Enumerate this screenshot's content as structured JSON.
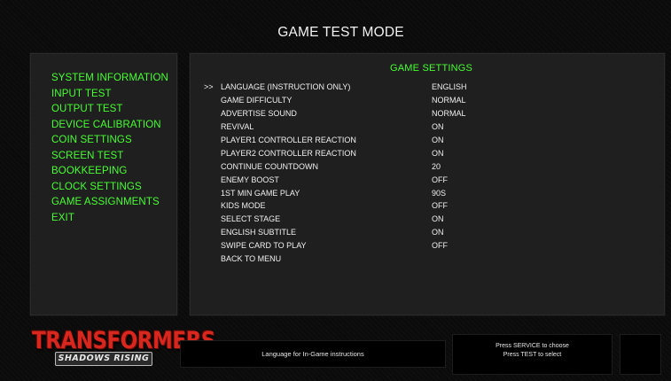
{
  "header": {
    "title": "GAME TEST MODE"
  },
  "menu": {
    "items": [
      "SYSTEM INFORMATION",
      "INPUT TEST",
      "OUTPUT TEST",
      "DEVICE CALIBRATION",
      "COIN SETTINGS",
      "SCREEN TEST",
      "BOOKKEEPING",
      "CLOCK SETTINGS",
      "GAME ASSIGNMENTS",
      "EXIT"
    ]
  },
  "settings": {
    "title": "GAME SETTINGS",
    "cursor": ">>",
    "rows": [
      {
        "label": "LANGUAGE (INSTRUCTION ONLY)",
        "value": "ENGLISH"
      },
      {
        "label": "GAME DIFFICULTY",
        "value": "NORMAL"
      },
      {
        "label": "ADVERTISE SOUND",
        "value": "NORMAL"
      },
      {
        "label": "REVIVAL",
        "value": "ON"
      },
      {
        "label": "PLAYER1 CONTROLLER REACTION",
        "value": "ON"
      },
      {
        "label": "PLAYER2 CONTROLLER REACTION",
        "value": "ON"
      },
      {
        "label": "CONTINUE COUNTDOWN",
        "value": "20"
      },
      {
        "label": "ENEMY BOOST",
        "value": "OFF"
      },
      {
        "label": "1ST MIN GAME PLAY",
        "value": "90S"
      },
      {
        "label": "KIDS MODE",
        "value": "OFF"
      },
      {
        "label": "SELECT STAGE",
        "value": "ON"
      },
      {
        "label": "ENGLISH SUBTITLE",
        "value": "ON"
      },
      {
        "label": "SWIPE CARD TO PLAY",
        "value": "OFF"
      }
    ],
    "back_label": "BACK TO MENU"
  },
  "logo": {
    "main": "TRANSFORMERS",
    "sub": "SHADOWS RISING"
  },
  "footer": {
    "description": "Language for In-Game instructions",
    "help_line1": "Press SERVICE to choose",
    "help_line2": "Press TEST to select"
  }
}
